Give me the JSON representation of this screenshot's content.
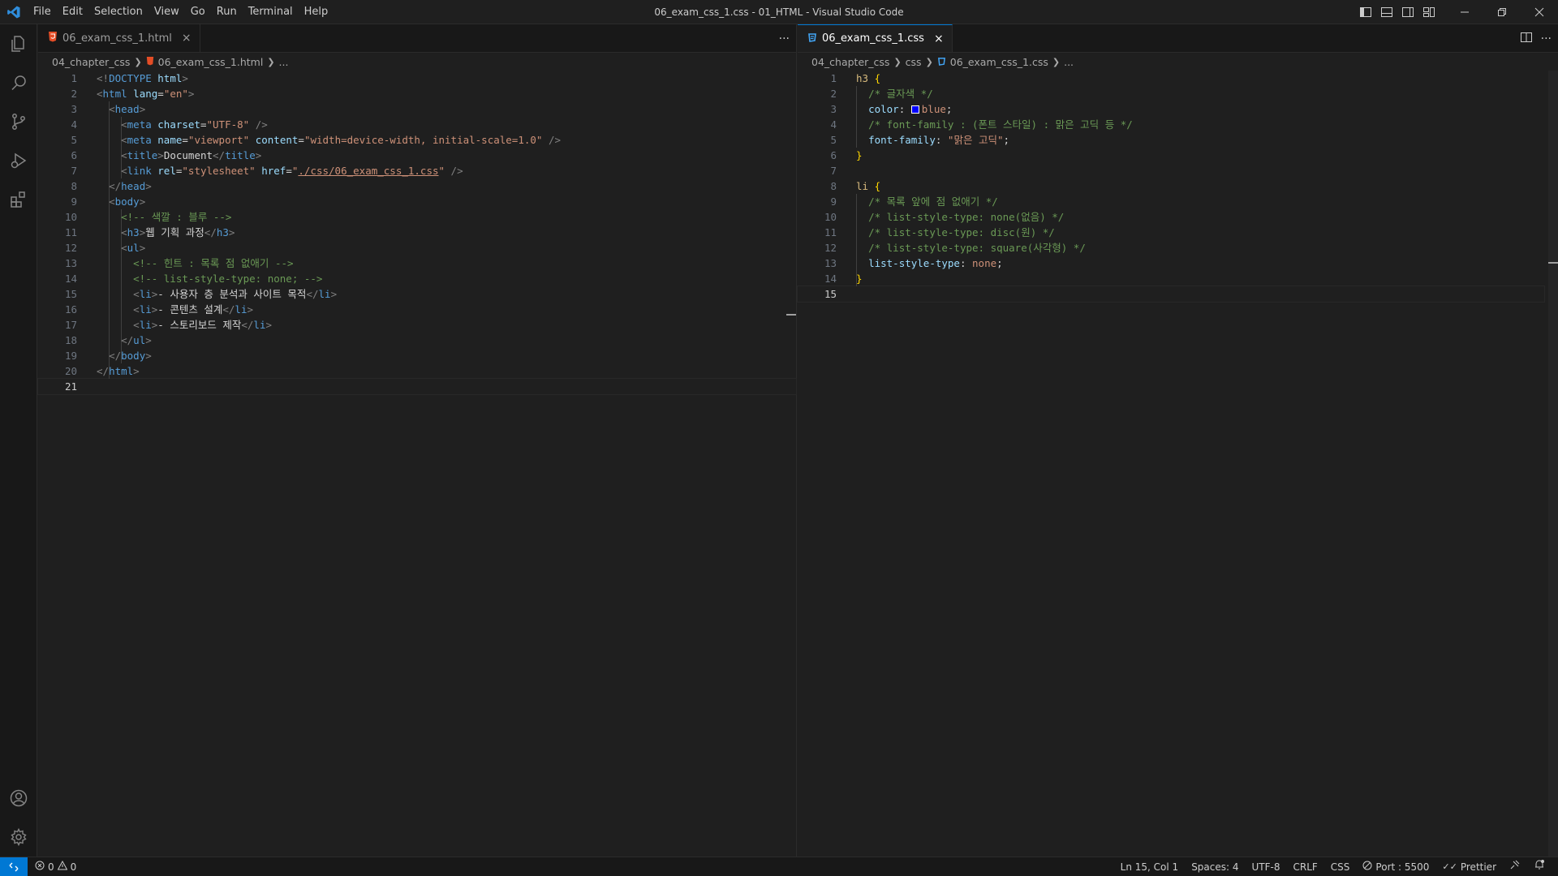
{
  "window": {
    "title": "06_exam_css_1.css - 01_HTML - Visual Studio Code"
  },
  "menu": [
    "File",
    "Edit",
    "Selection",
    "View",
    "Go",
    "Run",
    "Terminal",
    "Help"
  ],
  "left_group": {
    "tab": {
      "label": "06_exam_css_1.html",
      "close": "×"
    },
    "more": "···",
    "breadcrumb": [
      "04_chapter_css",
      "06_exam_css_1.html",
      "..."
    ],
    "line_numbers": [
      "1",
      "2",
      "3",
      "4",
      "5",
      "6",
      "7",
      "8",
      "9",
      "10",
      "11",
      "12",
      "13",
      "14",
      "15",
      "16",
      "17",
      "18",
      "19",
      "20",
      "21"
    ],
    "code": {
      "l1": {
        "a": "<!",
        "b": "DOCTYPE",
        "c": " html",
        "d": ">"
      },
      "l2": {
        "a": "<",
        "b": "html",
        "c": " lang",
        "d": "=",
        "e": "\"en\"",
        "f": ">"
      },
      "l3": {
        "a": "<",
        "b": "head",
        "c": ">"
      },
      "l4": {
        "a": "<",
        "b": "meta",
        "c": " charset",
        "d": "=",
        "e": "\"UTF-8\"",
        "f": " />"
      },
      "l5": {
        "a": "<",
        "b": "meta",
        "c": " name",
        "d": "=",
        "e": "\"viewport\"",
        "f": " content",
        "g": "=",
        "h": "\"width=device-width, initial-scale=1.0\"",
        "i": " />"
      },
      "l6": {
        "a": "<",
        "b": "title",
        "c": ">",
        "d": "Document",
        "e": "</",
        "f": "title",
        "g": ">"
      },
      "l7": {
        "a": "<",
        "b": "link",
        "c": " rel",
        "d": "=",
        "e": "\"stylesheet\"",
        "f": " href",
        "g": "=",
        "h": "\"",
        "i": "./css/06_exam_css_1.css",
        "j": "\"",
        "k": " />"
      },
      "l8": {
        "a": "</",
        "b": "head",
        "c": ">"
      },
      "l9": {
        "a": "<",
        "b": "body",
        "c": ">"
      },
      "l10": "<!-- 색깔 : 블루 -->",
      "l11": {
        "a": "<",
        "b": "h3",
        "c": ">",
        "d": "웹 기획 과정",
        "e": "</",
        "f": "h3",
        "g": ">"
      },
      "l12": {
        "a": "<",
        "b": "ul",
        "c": ">"
      },
      "l13": "<!-- 힌트 : 목록 점 없애기 -->",
      "l14": "<!-- list-style-type: none; -->",
      "l15": {
        "a": "<",
        "b": "li",
        "c": ">",
        "d": "- 사용자 층 분석과 사이트 목적",
        "e": "</",
        "f": "li",
        "g": ">"
      },
      "l16": {
        "a": "<",
        "b": "li",
        "c": ">",
        "d": "- 콘텐츠 설계",
        "e": "</",
        "f": "li",
        "g": ">"
      },
      "l17": {
        "a": "<",
        "b": "li",
        "c": ">",
        "d": "- 스토리보드 제작",
        "e": "</",
        "f": "li",
        "g": ">"
      },
      "l18": {
        "a": "</",
        "b": "ul",
        "c": ">"
      },
      "l19": {
        "a": "</",
        "b": "body",
        "c": ">"
      },
      "l20": {
        "a": "</",
        "b": "html",
        "c": ">"
      }
    }
  },
  "right_group": {
    "tab": {
      "label": "06_exam_css_1.css",
      "close": "×"
    },
    "breadcrumb": [
      "04_chapter_css",
      "css",
      "06_exam_css_1.css",
      "..."
    ],
    "line_numbers": [
      "1",
      "2",
      "3",
      "4",
      "5",
      "6",
      "7",
      "8",
      "9",
      "10",
      "11",
      "12",
      "13",
      "14",
      "15"
    ],
    "code": {
      "l1": {
        "sel": "h3",
        "brace": " {"
      },
      "l2": "/* 글자색 */",
      "l3": {
        "prop": "color",
        "colon": ": ",
        "val": "blue",
        "semi": ";"
      },
      "l4": "/* font-family : (폰트 스타일) : 맑은 고딕 등 */",
      "l5": {
        "prop": "font-family",
        "colon": ": ",
        "val": "\"맑은 고딕\"",
        "semi": ";"
      },
      "l6": "}",
      "l8": {
        "sel": "li",
        "brace": " {"
      },
      "l9": "/* 목록 앞에 점 없애기 */",
      "l10": "/* list-style-type: none(없음) */",
      "l11": "/* list-style-type: disc(원) */",
      "l12": "/* list-style-type: square(사각형) */",
      "l13": {
        "prop": "list-style-type",
        "colon": ": ",
        "val": "none",
        "semi": ";"
      },
      "l14": "}"
    }
  },
  "statusbar": {
    "errors": "0",
    "warnings": "0",
    "position": "Ln 15, Col 1",
    "spaces": "Spaces: 4",
    "encoding": "UTF-8",
    "eol": "CRLF",
    "language": "CSS",
    "port": "Port : 5500",
    "prettier": "Prettier"
  },
  "colors": {
    "accent": "#0078d4",
    "swatch": "#0000ff",
    "html_icon": "#e44d26",
    "css_icon": "#42a5f5"
  }
}
